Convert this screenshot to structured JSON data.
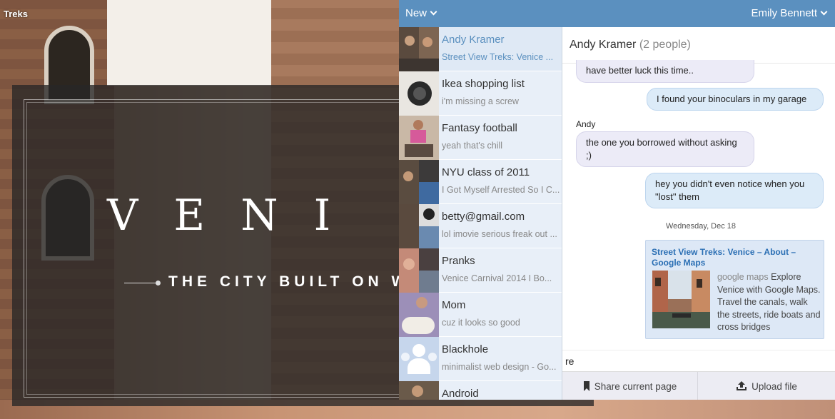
{
  "background": {
    "app_label": "Treks",
    "headline": "VENI",
    "subtitle": "THE CITY BUILT ON WA"
  },
  "topbar": {
    "new_label": "New",
    "user_name": "Emily Bennett"
  },
  "conversations": [
    {
      "name": "Andy Kramer",
      "snippet": "Street View Treks: Venice ...",
      "active": true
    },
    {
      "name": "Ikea shopping list",
      "snippet": "i'm missing a screw",
      "active": false
    },
    {
      "name": "Fantasy football",
      "snippet": "yeah that's chill",
      "active": false
    },
    {
      "name": "NYU class of 2011",
      "snippet": "I Got Myself Arrested So I C...",
      "active": false
    },
    {
      "name": "betty@gmail.com",
      "snippet": "lol imovie serious freak out ...",
      "active": false
    },
    {
      "name": "Pranks",
      "snippet": "Venice Carnival 2014 I Bo...",
      "active": false
    },
    {
      "name": "Mom",
      "snippet": "cuz it looks so good",
      "active": false
    },
    {
      "name": "Blackhole",
      "snippet": "minimalist web design - Go...",
      "active": false
    },
    {
      "name": "Android",
      "snippet": "",
      "active": false
    }
  ],
  "thread": {
    "title": "Andy Kramer",
    "participants": "(2 people)",
    "messages": [
      {
        "text": "have better luck this time..",
        "direction": "in"
      },
      {
        "text": "I found your binoculars in my garage",
        "direction": "out"
      },
      {
        "sender": "Andy",
        "text": "the one you borrowed without asking ;)",
        "direction": "in"
      },
      {
        "text": "hey you didn't even notice when you \"lost\" them",
        "direction": "out"
      }
    ],
    "date_separator": "Wednesday, Dec 18",
    "link_card": {
      "title": "Street View Treks: Venice – About – Google Maps",
      "source": "google maps",
      "description": "Explore Venice with Google Maps. Travel the canals, walk the streets, ride boats and cross bridges"
    }
  },
  "composer": {
    "value": "re"
  },
  "actions": {
    "share_label": "Share current page",
    "upload_label": "Upload file"
  }
}
